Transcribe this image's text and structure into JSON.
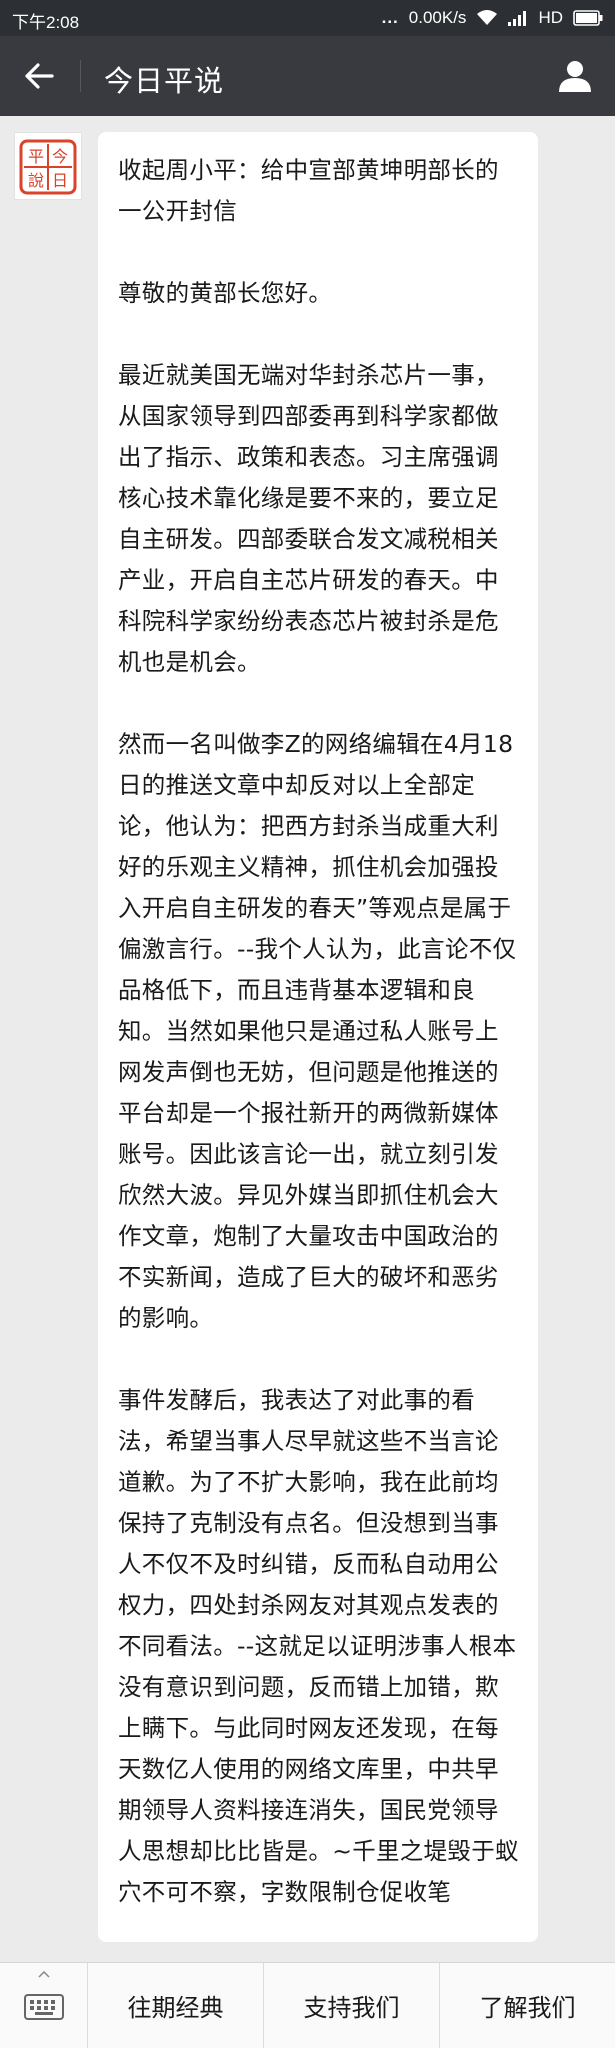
{
  "status_bar": {
    "time": "下午2:08",
    "dots": "...",
    "network_speed": "0.00K/s",
    "network_type": "HD"
  },
  "header": {
    "title": "今日平说"
  },
  "avatar": {
    "seal_text": "今日平說"
  },
  "message": {
    "paragraphs": [
      "收起周小平：给中宣部黄坤明部长的一公开封信",
      "尊敬的黄部长您好。",
      "最近就美国无端对华封杀芯片一事，从国家领导到四部委再到科学家都做出了指示、政策和表态。习主席强调核心技术靠化缘是要不来的，要立足自主研发。四部委联合发文减税相关产业，开启自主芯片研发的春天。中科院科学家纷纷表态芯片被封杀是危机也是机会。",
      "然而一名叫做李Z的网络编辑在4月18日的推送文章中却反对以上全部定论，他认为：把西方封杀当成重大利好的乐观主义精神，抓住机会加强投入开启自主研发的春天”等观点是属于偏激言行。--我个人认为，此言论不仅品格低下，而且违背基本逻辑和良知。当然如果他只是通过私人账号上网发声倒也无妨，但问题是他推送的平台却是一个报社新开的两微新媒体账号。因此该言论一出，就立刻引发欣然大波。异见外媒当即抓住机会大作文章，炮制了大量攻击中国政治的不实新闻，造成了巨大的破坏和恶劣的影响。",
      "事件发酵后，我表达了对此事的看法，希望当事人尽早就这些不当言论道歉。为了不扩大影响，我在此前均保持了克制没有点名。但没想到当事人不仅不及时纠错，反而私自动用公权力，四处封杀网友对其观点发表的不同看法。--这就足以证明涉事人根本没有意识到问题，反而错上加错，欺上瞒下。与此同时网友还发现，在每天数亿人使用的网络文库里，中共早期领导人资料接连消失，国民党领导人思想却比比皆是。~千里之堤毁于蚁穴不可不察，字数限制仓促收笔"
    ]
  },
  "bottom_menu": {
    "items": [
      {
        "label": "往期经典"
      },
      {
        "label": "支持我们"
      },
      {
        "label": "了解我们"
      }
    ]
  },
  "colors": {
    "status_bar_bg": "#2c2f33",
    "title_bar_bg": "#393a3f",
    "page_bg": "#ebebeb",
    "bubble_bg": "#ffffff",
    "seal_red": "#d8432b"
  }
}
